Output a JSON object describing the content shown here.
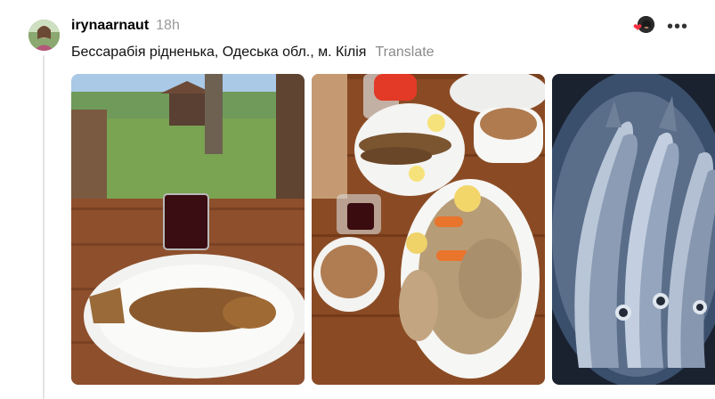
{
  "post": {
    "username": "irynaarnaut",
    "time": "18h",
    "caption": "Бессарабія рідненька, Одеська обл., м. Кілія",
    "translate_label": "Translate",
    "more_label": "•••",
    "heart_glyph": "❤"
  },
  "icons": {
    "avatar": "avatar",
    "liked_by": "liked-by-avatar",
    "heart": "heart-icon",
    "more": "more-options-icon"
  },
  "colors": {
    "heart": "#ff3040",
    "muted": "#999999",
    "thread_line": "#e3e3e3"
  }
}
